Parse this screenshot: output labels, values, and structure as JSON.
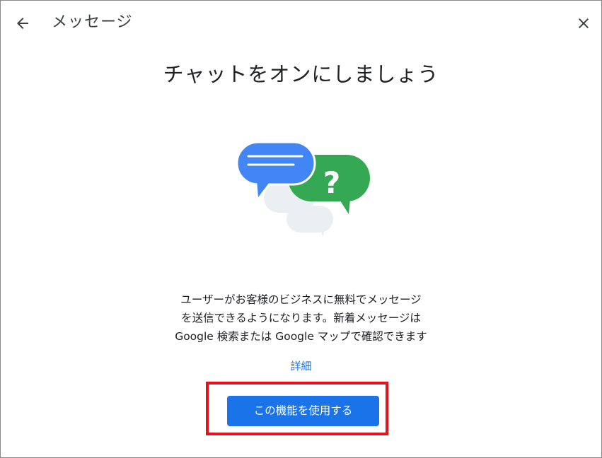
{
  "header": {
    "title": "メッセージ",
    "back_icon": "arrow-back-icon",
    "close_icon": "close-icon"
  },
  "main": {
    "headline": "チャットをオンにしましょう",
    "illustration": "chat-bubbles-illustration",
    "description_lines": [
      "ユーザーがお客様のビジネスに無料でメッセージ",
      "を送信できるようになります。新着メッセージは",
      "Google 検索または Google マップで確認できます"
    ],
    "learn_more_label": "詳細",
    "enable_button_label": "この機能を使用する"
  },
  "colors": {
    "accent_blue": "#1a73e8",
    "bubble_blue": "#4285f4",
    "bubble_green": "#34a853",
    "highlight_red": "#e5121d"
  }
}
